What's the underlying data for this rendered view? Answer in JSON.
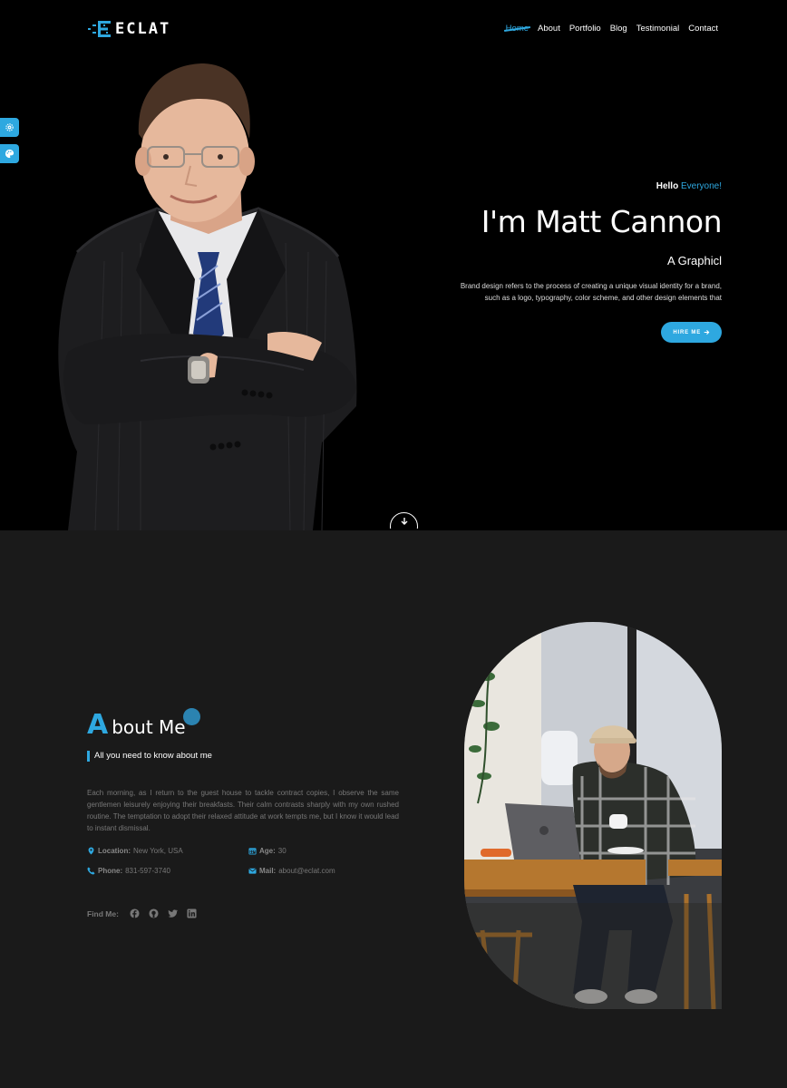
{
  "brand": {
    "logo_text": "ECLAT",
    "accent_color": "#2ea8e0"
  },
  "nav": {
    "items": [
      {
        "label": "Home",
        "active": true
      },
      {
        "label": "About",
        "active": false
      },
      {
        "label": "Portfolio",
        "active": false
      },
      {
        "label": "Blog",
        "active": false
      },
      {
        "label": "Testimonial",
        "active": false
      },
      {
        "label": "Contact",
        "active": false
      }
    ]
  },
  "side_tools": [
    {
      "icon": "gear-icon"
    },
    {
      "icon": "palette-icon"
    }
  ],
  "hero": {
    "greeting": "Hello",
    "greeting_accent": "Everyone!",
    "name": "I'm Matt Cannon",
    "role": "A Graphicl",
    "description": "Brand design refers to the process of creating a unique visual identity for a brand, such as a logo, typography, color scheme, and other design elements that",
    "cta_label": "HIRE ME",
    "cta_icon": "arrow-right-icon",
    "scroll_icon": "arrow-down-icon"
  },
  "about": {
    "title_initial": "A",
    "title_rest": "bout Me",
    "subtitle": "All you need to know about me",
    "paragraph": "Each morning, as I return to the guest house to tackle contract copies, I observe the same gentlemen leisurely enjoying their breakfasts. Their calm contrasts sharply with my own rushed routine. The temptation to adopt their relaxed attitude at work tempts me, but I know it would lead to instant dismissal.",
    "details": {
      "location_label": "Location:",
      "location_value": "New York, USA",
      "age_label": "Age:",
      "age_value": "30",
      "phone_label": "Phone:",
      "phone_value": "831-597-3740",
      "mail_label": "Mail:",
      "mail_value": "about@eclat.com"
    },
    "find_me_label": "Find Me:",
    "socials": [
      "facebook-icon",
      "github-icon",
      "twitter-icon",
      "linkedin-icon"
    ]
  }
}
